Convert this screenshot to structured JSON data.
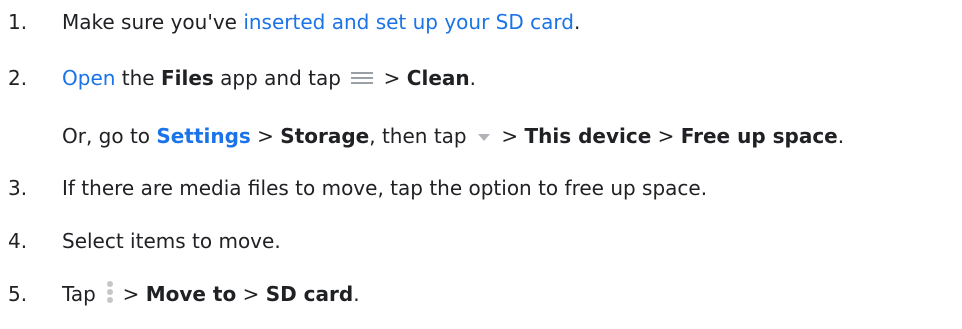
{
  "steps": [
    {
      "number": "1.",
      "text_a": "Make sure you've ",
      "link": "inserted and set up your SD card",
      "text_b": "."
    },
    {
      "number": "2.",
      "link": "Open",
      "text_a": " the ",
      "bold_files": "Files",
      "text_b": " app and tap ",
      "icon": "menu-icon",
      "text_c": " > ",
      "bold_clean": "Clean",
      "text_d": "."
    },
    {
      "text_a": "Or, go to ",
      "link_settings": "Settings",
      "text_b": " > ",
      "bold_storage": "Storage",
      "text_c": ", then tap ",
      "icon": "dropdown-caret-icon",
      "text_d": " > ",
      "bold_device": "This device",
      "text_e": " > ",
      "bold_free": "Free up space",
      "text_f": "."
    },
    {
      "number": "3.",
      "text": "If there are media files to move, tap the option to free up space."
    },
    {
      "number": "4.",
      "text": "Select items to move."
    },
    {
      "number": "5.",
      "text_a": "Tap ",
      "icon": "more-vert-icon",
      "text_b": " > ",
      "bold_move": "Move to",
      "text_c": " > ",
      "bold_sd": "SD card",
      "text_d": "."
    }
  ],
  "colors": {
    "link": "#1a73e8",
    "text": "#202124",
    "icon": "#9aa0a6"
  }
}
